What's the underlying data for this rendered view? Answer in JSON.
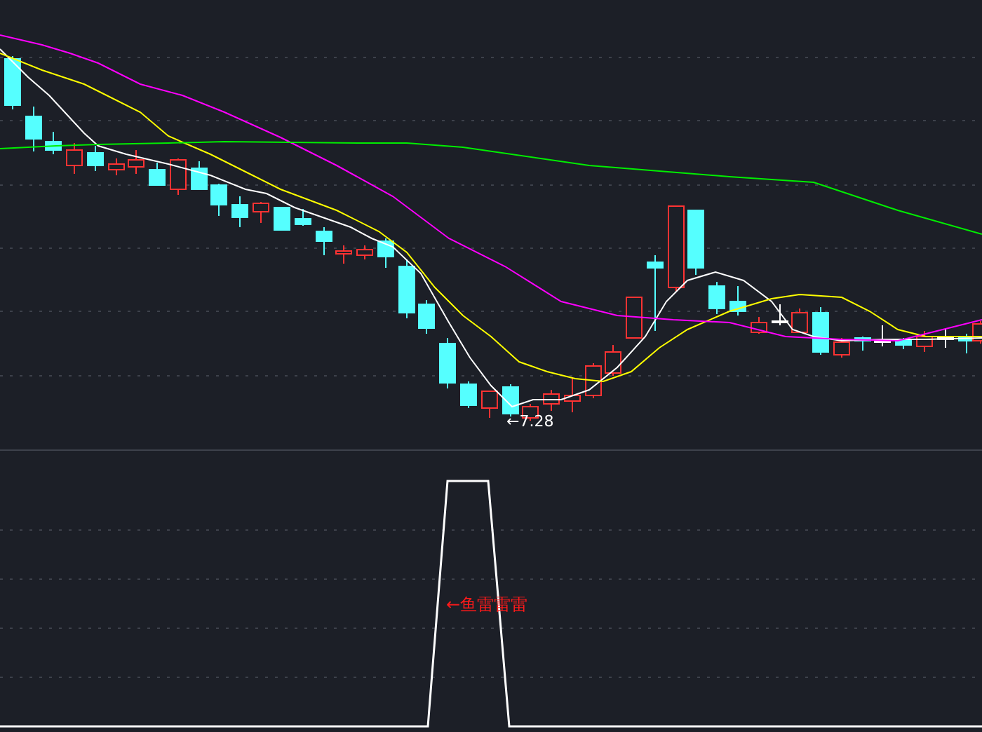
{
  "price_panel": {
    "low_label": "←7.28"
  },
  "signal_panel": {
    "label": "←鱼雷雷雷"
  }
}
